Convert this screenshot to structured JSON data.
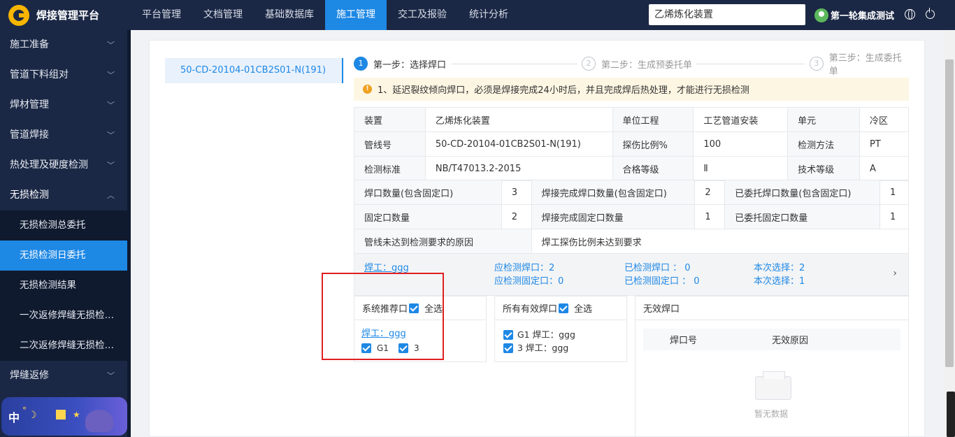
{
  "app": {
    "title": "焊接管理平台"
  },
  "nav": [
    "平台管理",
    "文档管理",
    "基础数据库",
    "施工管理",
    "交工及报验",
    "统计分析"
  ],
  "search": {
    "value": "乙烯炼化装置"
  },
  "user": {
    "name": "第一轮集成测试"
  },
  "sidebar": {
    "items": [
      "施工准备",
      "管道下料组对",
      "焊材管理",
      "管道焊接",
      "热处理及硬度检测",
      "无损检测"
    ],
    "sub_items": [
      "无损检测总委托",
      "无损检测日委托",
      "无损检测结果",
      "一次返修焊缝无损检测...",
      "二次返修焊缝无损检测..."
    ],
    "items_after": [
      "焊缝返修"
    ],
    "active_sub": "无损检测日委托"
  },
  "banner": {
    "text": "中"
  },
  "pipeline": {
    "selected": "50-CD-20104-01CB2S01-N(191)"
  },
  "steps": [
    {
      "num": "1",
      "label": "第一步：选择焊口"
    },
    {
      "num": "2",
      "label": "第二步：生成预委托单"
    },
    {
      "num": "3",
      "label": "第三步：生成委托单"
    }
  ],
  "warning": "1、延迟裂纹倾向焊口，必须是焊接完成24小时后，并且完成焊后热处理，才能进行无损检测",
  "info": {
    "rows": [
      [
        "装置",
        "乙烯炼化装置",
        "单位工程",
        "工艺管道安装",
        "单元",
        "冷区"
      ],
      [
        "管线号",
        "50-CD-20104-01CB2S01-N(191)",
        "探伤比例%",
        "100",
        "检测方法",
        "PT"
      ],
      [
        "检测标准",
        "NB/T47013.2-2015",
        "合格等级",
        "Ⅱ",
        "技术等级",
        "A"
      ]
    ],
    "counts": [
      [
        "焊口数量(包含固定口)",
        "3",
        "焊接完成焊口数量(包含固定口)",
        "2",
        "已委托焊口数量(包含固定口)",
        "1"
      ],
      [
        "固定口数量",
        "2",
        "焊接完成固定口数量",
        "1",
        "已委托固定口数量",
        "1"
      ]
    ],
    "reason_label": "管线未达到检测要求的原因",
    "reason_value": "焊工探伤比例未达到要求"
  },
  "summary": {
    "welder": "焊工：ggg",
    "should_weld": "应检测焊口：2",
    "should_fixed": "应检测固定口：0",
    "done_weld": "已检测焊口 ： 0",
    "done_fixed": "已检测固定口 ： 0",
    "sel_weld": "本次选择：2",
    "sel_fixed": "本次选择：1",
    "arrow": "›"
  },
  "panels": {
    "recommend": {
      "title": "系统推荐口",
      "select_all": "全选",
      "welder": "焊工：ggg",
      "items": [
        "G1",
        "3"
      ]
    },
    "valid": {
      "title": "所有有效焊口",
      "select_all": "全选",
      "items": [
        "G1 焊工：ggg",
        "3 焊工：ggg"
      ]
    },
    "invalid": {
      "title": "无效焊口",
      "col1": "焊口号",
      "col2": "无效原因",
      "empty": "暂无数据"
    }
  }
}
